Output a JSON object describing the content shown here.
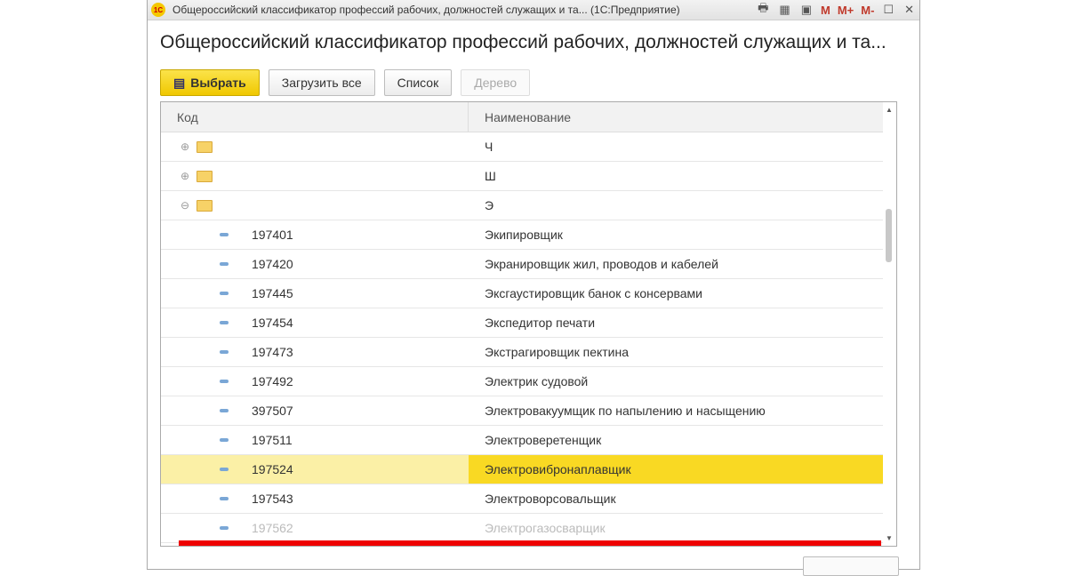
{
  "window": {
    "title": "Общероссийский классификатор профессий рабочих, должностей служащих и та... (1С:Предприятие)",
    "logo": "1С",
    "memory": [
      "M",
      "M+",
      "M-"
    ]
  },
  "form": {
    "heading": "Общероссийский классификатор профессий рабочих, должностей служащих и та..."
  },
  "toolbar": {
    "select": "Выбрать",
    "load_all": "Загрузить все",
    "list": "Список",
    "tree": "Дерево"
  },
  "table": {
    "columns": [
      "Код",
      "Наименование"
    ],
    "groups": [
      {
        "name": "Ч",
        "expanded": false
      },
      {
        "name": "Ш",
        "expanded": false
      },
      {
        "name": "Э",
        "expanded": true
      }
    ],
    "items": [
      {
        "code": "197401",
        "name": "Экипировщик"
      },
      {
        "code": "197420",
        "name": "Экранировщик жил, проводов и кабелей"
      },
      {
        "code": "197445",
        "name": "Эксгаустировщик банок с консервами"
      },
      {
        "code": "197454",
        "name": "Экспедитор печати"
      },
      {
        "code": "197473",
        "name": "Экстрагировщик пектина"
      },
      {
        "code": "197492",
        "name": "Электрик судовой"
      },
      {
        "code": "397507",
        "name": "Электровакуумщик по напылению и насыщению"
      },
      {
        "code": "197511",
        "name": "Электроверетенщик"
      },
      {
        "code": "197524",
        "name": "Электровибронаплавщик",
        "selected": true
      },
      {
        "code": "197543",
        "name": "Электроворсовальщик"
      },
      {
        "code": "197562",
        "name": "Электрогазосварщик"
      }
    ]
  },
  "colors": {
    "selected": "#f9d923",
    "highlight": "#e00000"
  }
}
